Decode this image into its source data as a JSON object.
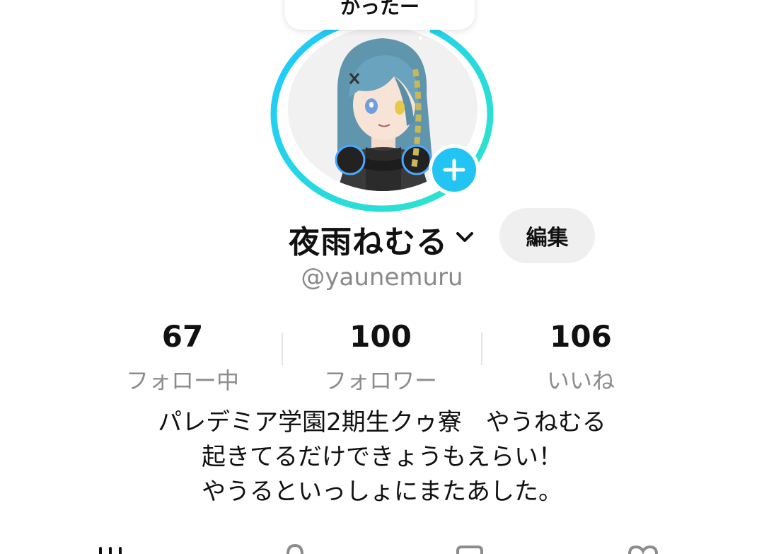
{
  "bubble": {
    "text": "かったー"
  },
  "profile": {
    "display_name": "夜雨ねむる",
    "handle": "@yaunemuru",
    "edit_label": "編集"
  },
  "stats": [
    {
      "value": "67",
      "label": "フォロー中"
    },
    {
      "value": "100",
      "label": "フォロワー"
    },
    {
      "value": "106",
      "label": "いいね"
    }
  ],
  "bio": [
    "パレデミア学園2期生クゥ寮　やうねむる",
    "起きてるだけできょうもえらい！",
    "やうるといっしょにまたあした。"
  ],
  "colors": {
    "ring_start": "#1ec8ff",
    "ring_end": "#2ee6c8",
    "add_button": "#21c4f2"
  },
  "icons": [
    "plus-icon",
    "chevron-down-icon",
    "grid-icon",
    "lock-icon",
    "bookmark-icon",
    "heart-icon"
  ]
}
